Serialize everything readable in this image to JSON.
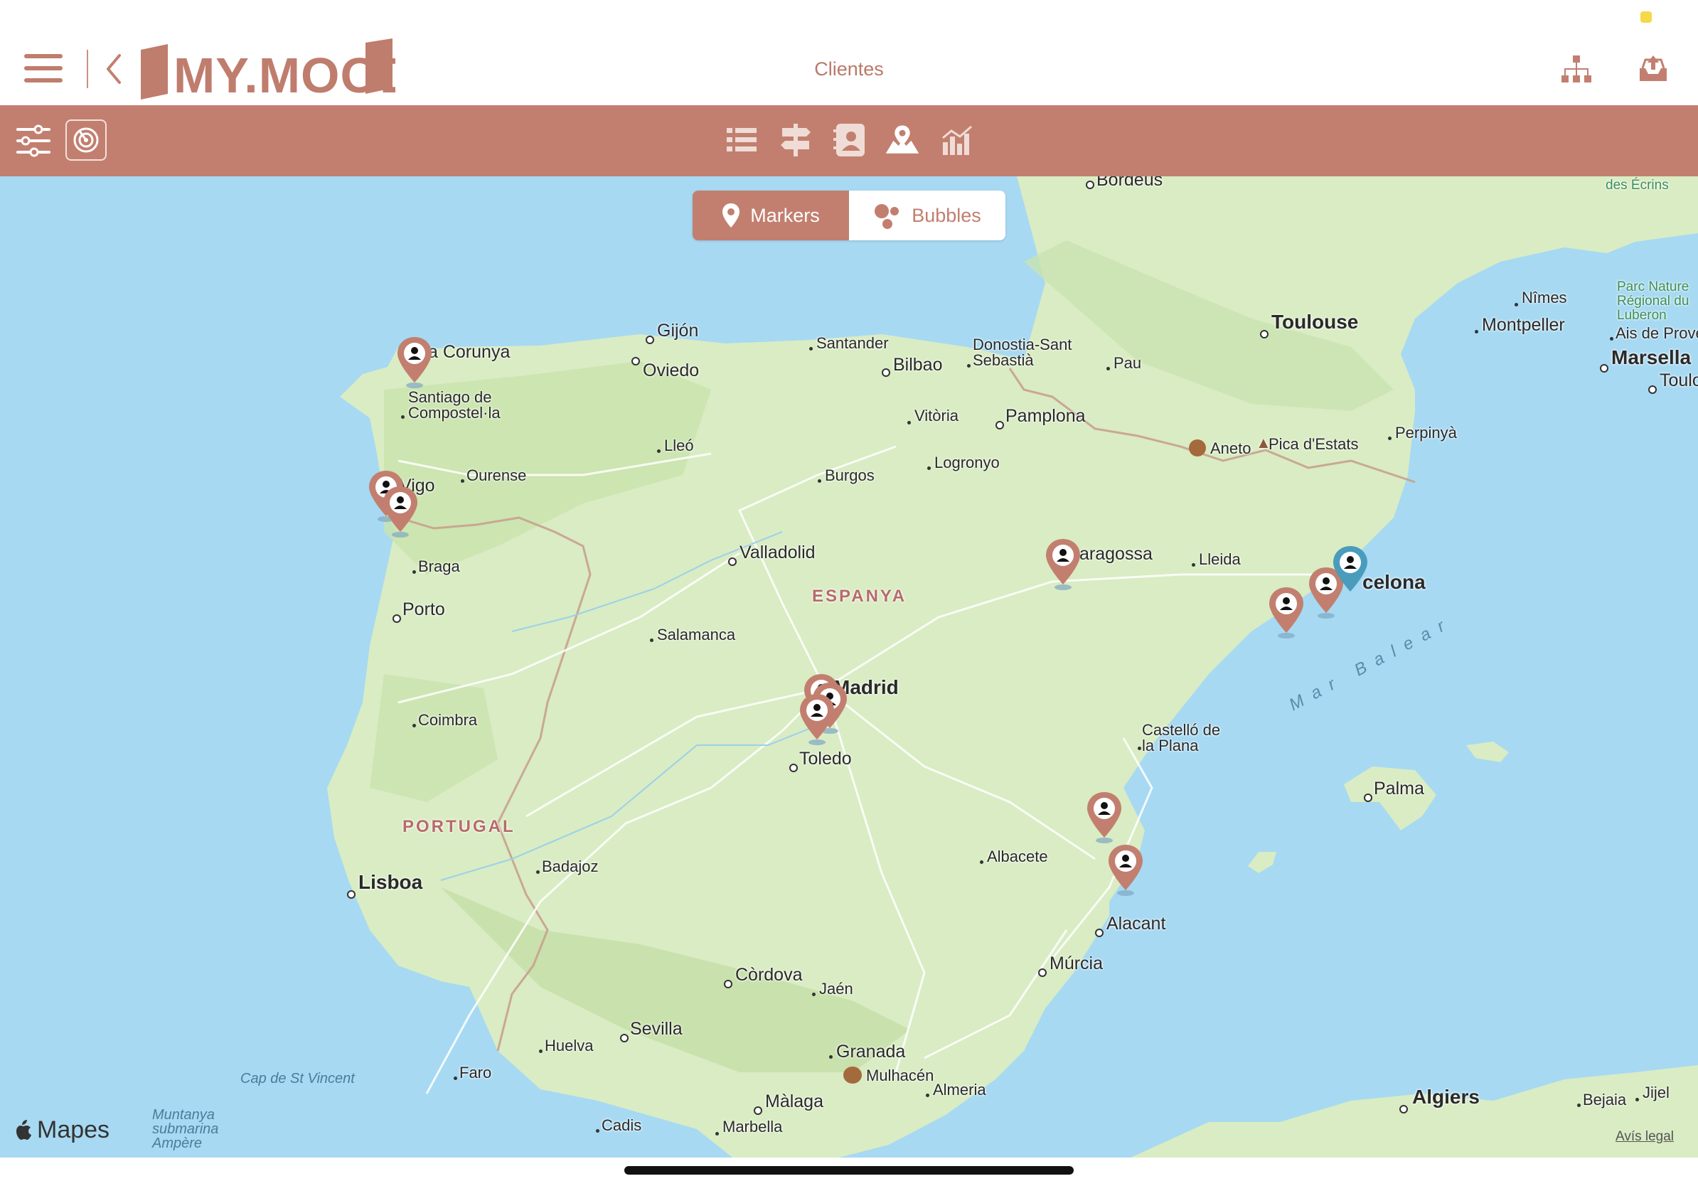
{
  "header": {
    "title": "Clientes",
    "logo_text": "MY.MOOD"
  },
  "icons": {
    "menu": "hamburger-icon",
    "back": "chevron-left-icon",
    "hierarchy": "hierarchy-icon",
    "upload": "upload-tray-icon",
    "filter": "sliders-icon",
    "radar": "radar-icon",
    "list": "list-icon",
    "directions": "signpost-icon",
    "contacts": "contact-card-icon",
    "map": "map-pin-icon",
    "stats": "bar-chart-icon"
  },
  "colors": {
    "brand": "#c27f6f",
    "marker": "#c27f6f",
    "marker_selected": "#4a9cbc",
    "sea": "#a7d9f2",
    "land": "#d9ecc3"
  },
  "map_toggle": {
    "markers_label": "Markers",
    "bubbles_label": "Bubbles",
    "selected": "Markers"
  },
  "map": {
    "attribution": "Mapes",
    "legal": "Avís legal",
    "countries": [
      "ESPANYA",
      "PORTUGAL"
    ],
    "sea": "Mar Balear",
    "water_labels": [
      "Cap de St Vincent",
      "Muntanya submarina Ampère"
    ],
    "parks": [
      "des Écrins",
      "Parc Nature Régional du Luberon"
    ],
    "peaks": [
      "Aneto",
      "Pica d'Estats",
      "Mulhacén"
    ],
    "cities": {
      "bordeus": "Bordeus",
      "toulouse": "Toulouse",
      "nimes": "Nîmes",
      "montpeller": "Montpeller",
      "aix": "Ais de Prove",
      "marsella": "Marsella",
      "toulon": "Toulo",
      "acoruna": "a Corunya",
      "gijon": "Gijón",
      "oviedo": "Oviedo",
      "santander": "Santander",
      "bilbao": "Bilbao",
      "donostia1": "Donostia-Sant",
      "donostia2": "Sebastià",
      "pau": "Pau",
      "santiago1": "Santiago de",
      "santiago2": "Compostel·la",
      "vitoria": "Vitòria",
      "pamplona": "Pamplona",
      "perpinya": "Perpinyà",
      "lleo": "Lleó",
      "ourense": "Ourense",
      "vigo": "Vigo",
      "burgos": "Burgos",
      "logronyo": "Logronyo",
      "braga": "Braga",
      "valladolid": "Valladolid",
      "zaragossa": "aragossa",
      "lleida": "Lleida",
      "barcelona": "celona",
      "porto": "Porto",
      "salamanca": "Salamanca",
      "madrid": "Madrid",
      "coimbra": "Coimbra",
      "castello1": "Castelló de",
      "castello2": "la Plana",
      "toledo": "Toledo",
      "palma": "Palma",
      "albacete": "Albacete",
      "badajoz": "Badajoz",
      "lisboa": "Lisboa",
      "alacant": "Alacant",
      "murcia": "Múrcia",
      "cordova": "Còrdova",
      "jaen": "Jaén",
      "sevilla": "Sevilla",
      "huelva": "Huelva",
      "granada": "Granada",
      "faro": "Faro",
      "almeria": "Almeria",
      "malaga": "Màlaga",
      "cadis": "Cadis",
      "marbella": "Marbella",
      "algiers": "Algiers",
      "bejaia": "Bejaia",
      "jijel": "Jijel"
    }
  }
}
